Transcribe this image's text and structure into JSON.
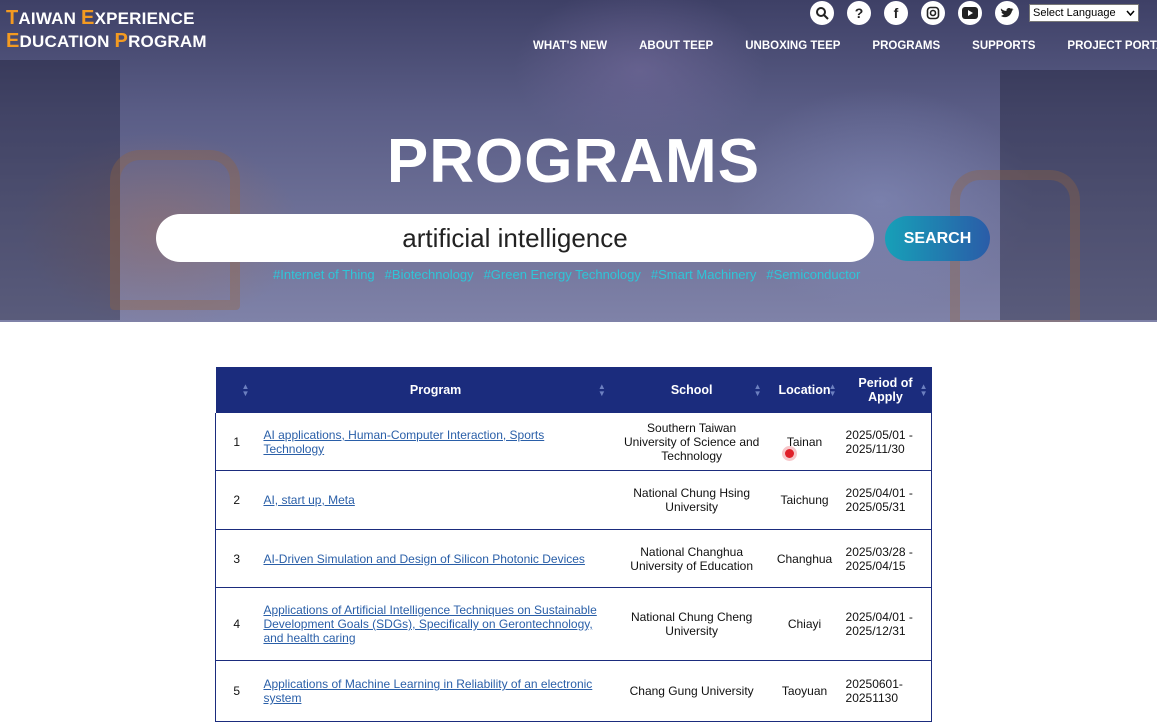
{
  "logo": {
    "l1a": "T",
    "l1b": "AIWAN ",
    "l1c": "E",
    "l1d": "XPERIENCE",
    "l2a": "E",
    "l2b": "DUCATION ",
    "l2c": "P",
    "l2d": "ROGRAM"
  },
  "icons": [
    "search-icon",
    "question-icon",
    "facebook-icon",
    "instagram-icon",
    "youtube-icon",
    "twitter-icon"
  ],
  "language": {
    "selected": "Select Language"
  },
  "nav": [
    "WHAT'S NEW",
    "ABOUT TEEP",
    "UNBOXING TEEP",
    "PROGRAMS",
    "SUPPORTS",
    "PROJECT PORTAL"
  ],
  "hero": {
    "title": "PROGRAMS",
    "search_value": "artificial intelligence",
    "search_button": "SEARCH",
    "tags": [
      "#Internet of Thing",
      "#Biotechnology",
      "#Green Energy Technology",
      "#Smart Machinery",
      "#Semiconductor"
    ]
  },
  "table": {
    "headers": [
      "",
      "Program",
      "School",
      "Location",
      "Period of Apply"
    ],
    "rows": [
      {
        "no": "1",
        "program": "AI applications, Human-Computer Interaction, Sports Technology",
        "school": "Southern Taiwan University of Science and Technology",
        "location": "Tainan",
        "period": "2025/05/01 - 2025/11/30"
      },
      {
        "no": "2",
        "program": "AI, start up, Meta",
        "school": "National Chung Hsing University",
        "location": "Taichung",
        "period": "2025/04/01 - 2025/05/31"
      },
      {
        "no": "3",
        "program": "AI-Driven Simulation and Design of Silicon Photonic Devices",
        "school": "National Changhua University of Education",
        "location": "Changhua",
        "period": "2025/03/28 - 2025/04/15"
      },
      {
        "no": "4",
        "program": "Applications of Artificial Intelligence Techniques on Sustainable Development Goals (SDGs), Specifically on Gerontechnology, and health caring",
        "school": "National Chung Cheng University",
        "location": "Chiayi",
        "period": "2025/04/01 - 2025/12/31"
      },
      {
        "no": "5",
        "program": "Applications of Machine Learning in Reliability of an electronic system",
        "school": "Chang Gung University",
        "location": "Taoyuan",
        "period": "20250601-20251130"
      }
    ]
  },
  "colors": {
    "header_blue": "#1b2c7d",
    "accent_orange": "#f39a21",
    "tag_cyan": "#2ec6d8",
    "link_blue": "#2a5fa8"
  }
}
